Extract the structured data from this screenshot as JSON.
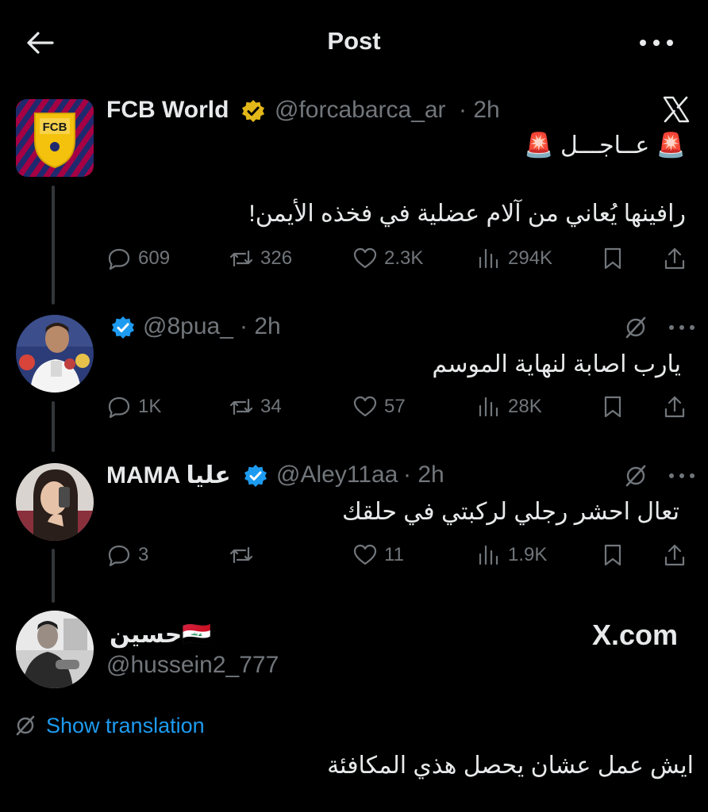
{
  "header": {
    "title": "Post",
    "back_icon": "arrow-left-icon",
    "more_icon": "more-horizontal-icon"
  },
  "watermark": {
    "logo": "x-logo-icon",
    "site": "X.com"
  },
  "posts": [
    {
      "name": "FCB World",
      "handle": "@forcabarca_ar",
      "time": "· 2h",
      "verified": "gold",
      "line1": "🚨 عــاجـــل 🚨",
      "line2": "رافينها يُعاني من آلام عضلية في فخذه الأيمن!",
      "replies": "609",
      "reposts": "326",
      "likes": "2.3K",
      "views": "294K"
    },
    {
      "name": "",
      "handle": "@8pua_",
      "time": "· 2h",
      "verified": "blue",
      "line1": "يارب اصابة لنهاية الموسم",
      "replies": "1K",
      "reposts": "34",
      "likes": "57",
      "views": "28K"
    },
    {
      "name": "MAMA عليا",
      "handle": "@Aley11aa",
      "time": "· 2h",
      "verified": "blue",
      "line1": "تعال احشر رجلي لركبتي في حلقك",
      "replies": "3",
      "reposts": "",
      "likes": "11",
      "views": "1.9K"
    },
    {
      "name": "حسين🇮🇶",
      "handle": "@hussein2_777",
      "translation_label": "Show translation",
      "line1": "ايش  عمل عشان يحصل هذي المكافئة"
    }
  ],
  "colors": {
    "background": "#000000",
    "text": "#e7e9ea",
    "muted": "#71767b",
    "link": "#1d9bf0",
    "gold": "#e2b719",
    "blue": "#1d9bf0"
  }
}
